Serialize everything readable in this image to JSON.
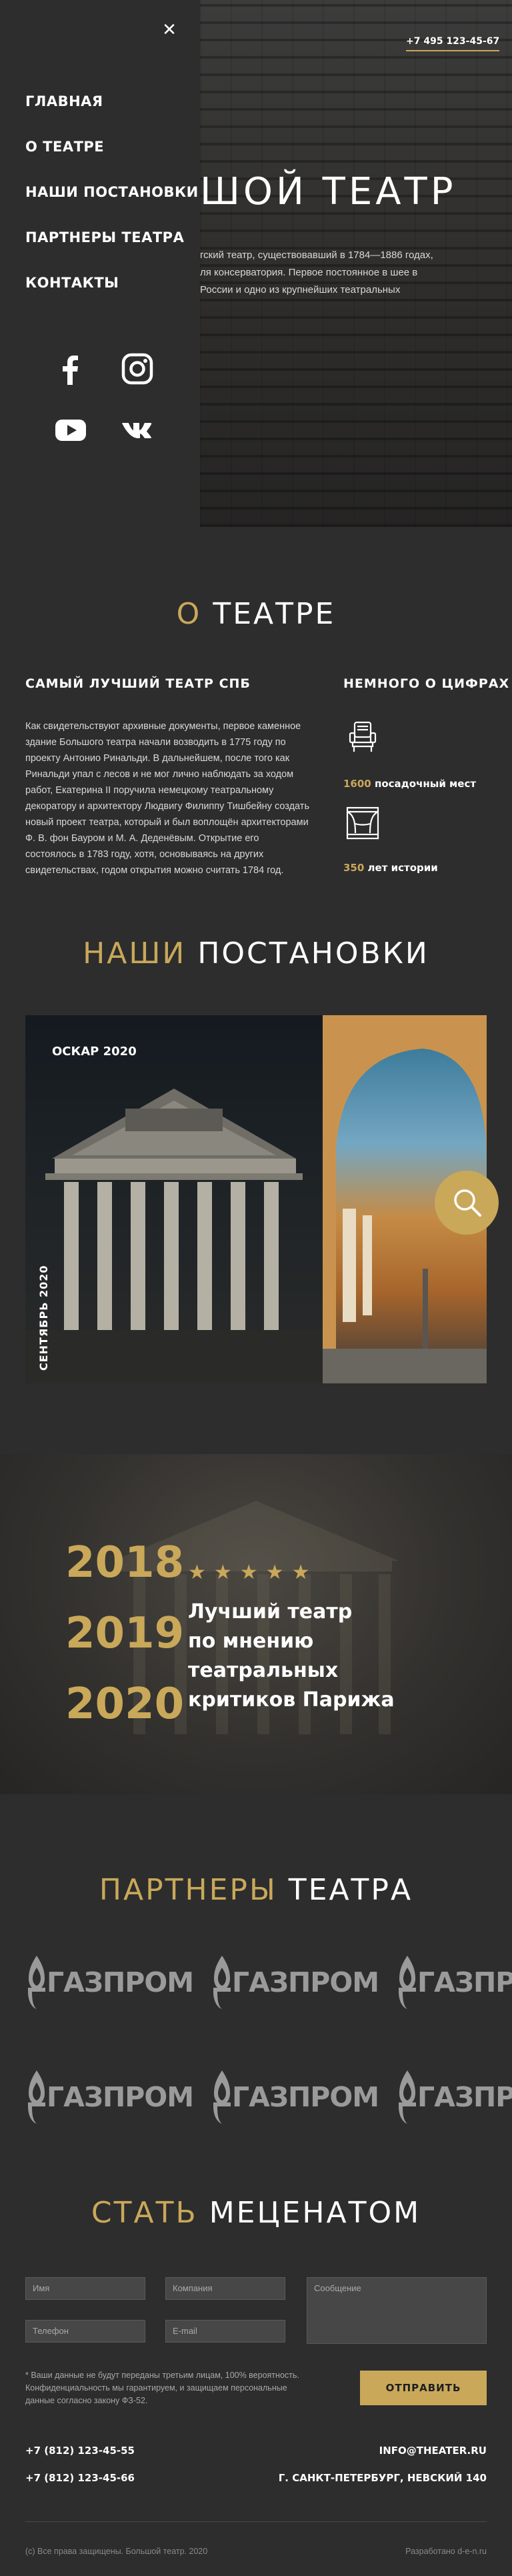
{
  "colors": {
    "accent": "#c9a85a",
    "background": "#2d2d2d"
  },
  "menu": {
    "close_icon": "close-icon",
    "items": [
      "ГЛАВНАЯ",
      "О ТЕАТРЕ",
      "НАШИ ПОСТАНОВКИ",
      "ПАРТНЕРЫ ТЕАТРА",
      "КОНТАКТЫ"
    ],
    "social": [
      "facebook-icon",
      "instagram-icon",
      "youtube-icon",
      "vk-icon"
    ]
  },
  "hero": {
    "phone": "+7 495 123-45-67",
    "title": "ШОЙ ТЕАТР",
    "text": "гский театр, существовавший в 1784—1886 годах, ля консерватория. Первое постоянное в шее в России и одно из крупнейших театральных"
  },
  "about": {
    "title_accent": "О",
    "title_rest": "ТЕАТРЕ",
    "heading": "САМЫЙ ЛУЧШИЙ ТЕАТР СПБ",
    "body": "Как свидетельствуют архивные документы, первое каменное здание Большого театра начали возводить в 1775 году по проекту Антонио Ринальди. В дальнейшем, после того как Ринальди упал с лесов и не мог лично наблюдать за ходом работ, Екатерина II поручила немецкому театральному декоратору и архитектору Людвигу Филиппу Тишбейну создать новый проект театра, который и был воплощён архитекторами Ф. В. фон Бауром и М. А. Деденёвым. Открытие его состоялось в 1783 году, хотя, основываясь на других свидетельствах, годом открытия можно считать 1784 год.",
    "stats_heading": "НЕМНОГО О ЦИФРАХ",
    "stats": [
      {
        "icon": "theater-seat-icon",
        "number": "1600",
        "label": "посадочный мест"
      },
      {
        "icon": "theater-stage-icon",
        "number": "350",
        "label": "лет истории"
      }
    ]
  },
  "productions": {
    "title_accent": "НАШИ",
    "title_rest": "ПОСТАНОВКИ",
    "card_label": "ОСКАР 2020",
    "card_date": "СЕНТЯБРЬ 2020",
    "zoom_icon": "search-icon"
  },
  "award": {
    "years": [
      "2018",
      "2019",
      "2020"
    ],
    "stars": "★★★★★",
    "text": [
      "Лучший театр",
      "по мнению театральных",
      "критиков Парижа"
    ]
  },
  "partners": {
    "title_accent": "ПАРТНЕРЫ",
    "title_rest": "ТЕАТРА",
    "logos": [
      "ГАЗПРОМ",
      "ГАЗПРОМ",
      "ГАЗПРОМ",
      "ГАЗПРОМ",
      "ГАЗПРОМ",
      "ГАЗПРОМ"
    ]
  },
  "patron": {
    "title_accent": "СТАТЬ",
    "title_rest": "МЕЦЕНАТОМ",
    "fields": {
      "name": "Имя",
      "company": "Компания",
      "message": "Сообщение",
      "phone": "Телефон",
      "email": "E-mail"
    },
    "note": "* Ваши данные не будут переданы третьим лицам, 100% вероятность. Конфиденциальность мы гарантируем, и защищаем персональные данные согласно закону ФЗ-52.",
    "submit": "ОТПРАВИТЬ"
  },
  "footer": {
    "phone1": "+7 (812) 123-45-55",
    "phone2": "+7 (812) 123-45-66",
    "email": "INFO@THEATER.RU",
    "address": "Г. САНКТ-ПЕТЕРБУРГ, НЕВСКИЙ 140",
    "copyright": "(с) Все права защищены. Большой театр. 2020",
    "credit": "Разработано d-e-n.ru"
  }
}
